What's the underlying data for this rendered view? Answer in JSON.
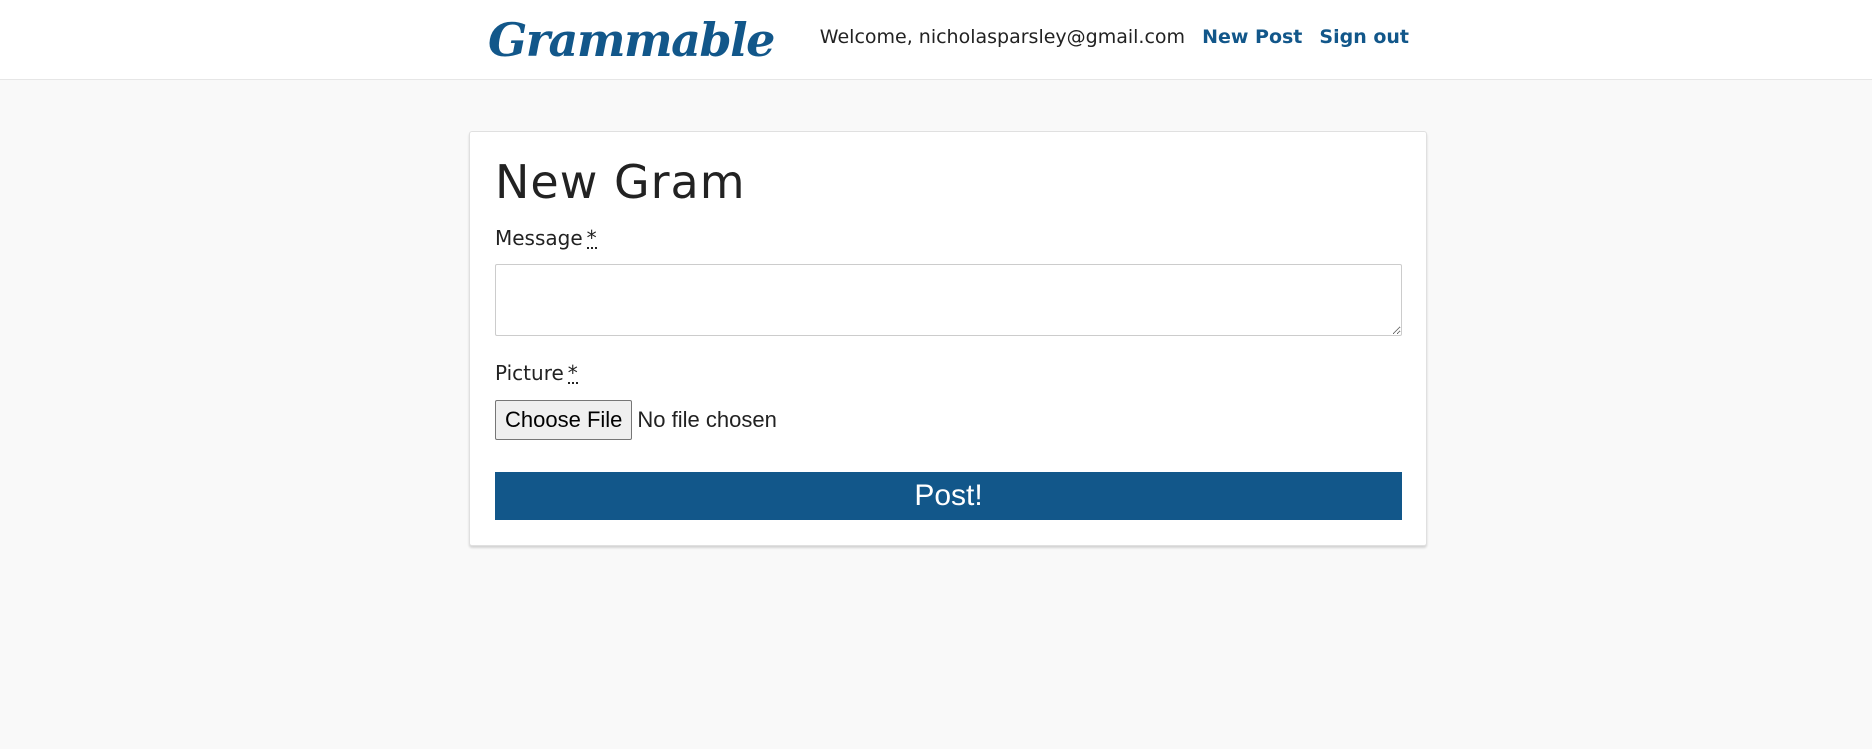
{
  "nav": {
    "brand": "Grammable",
    "welcome": "Welcome, nicholasparsley@gmail.com",
    "new_post": "New Post",
    "sign_out": "Sign out"
  },
  "form": {
    "title": "New Gram",
    "message_label": "Message",
    "message_value": "",
    "picture_label": "Picture",
    "required_marker": "*",
    "file_button": "Choose File",
    "file_status": "No file chosen",
    "submit": "Post!"
  },
  "colors": {
    "brand": "#12578a",
    "background": "#f9f9f9",
    "card": "#ffffff"
  },
  "icons": {
    "textarea_resize": "resize-handle-icon"
  }
}
